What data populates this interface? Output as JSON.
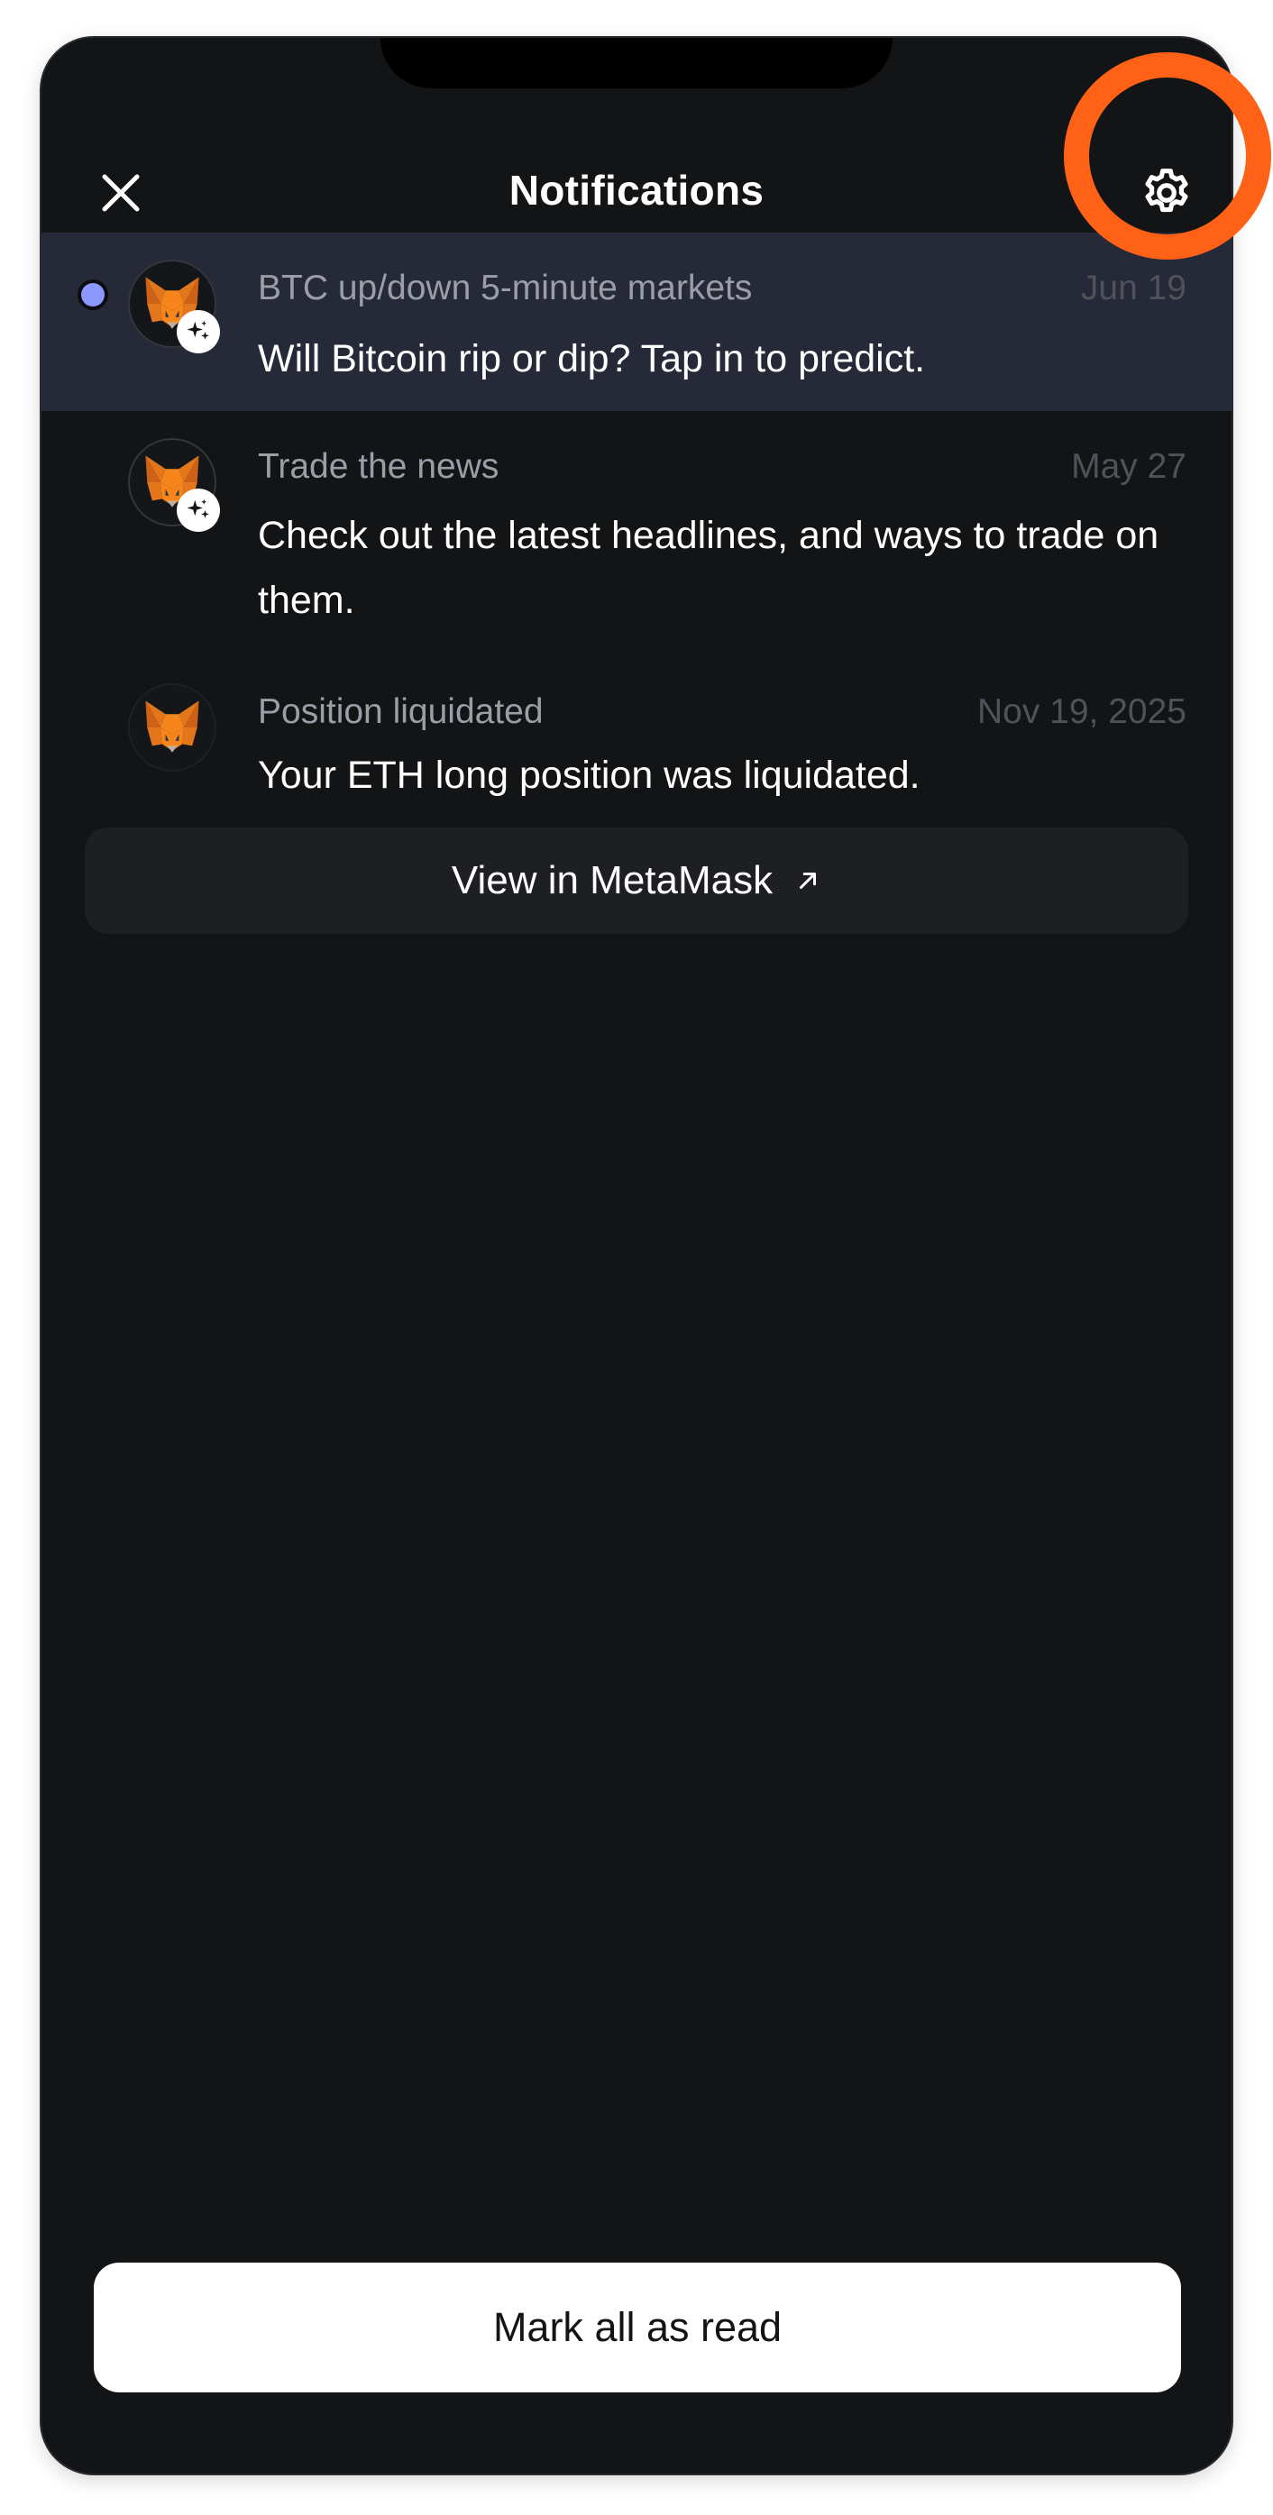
{
  "header": {
    "title": "Notifications"
  },
  "notifications": [
    {
      "title": "BTC up/down 5-minute markets",
      "date": "Jun 19",
      "body": "Will Bitcoin rip or dip? Tap in to predict.",
      "unread": true,
      "icon": "metamask-fox-icon",
      "badge_icon": "sparkle-icon"
    },
    {
      "title": "Trade the news",
      "date": "May 27",
      "body": "Check out the latest headlines, and ways to trade on them.",
      "unread": false,
      "icon": "metamask-fox-icon",
      "badge_icon": "sparkle-icon"
    },
    {
      "title": "Position liquidated",
      "date": "Nov 19, 2025",
      "body": "Your ETH long position was liquidated.",
      "unread": false,
      "icon": "metamask-fox-icon"
    }
  ],
  "view_link": {
    "label": "View in MetaMask",
    "icon": "external-arrow-icon"
  },
  "footer": {
    "mark_all_label": "Mark all as read"
  },
  "colors": {
    "background": "#131416",
    "unread_row": "#262a38",
    "unread_dot": "#8b99ff",
    "highlight_ring": "#ff6116"
  }
}
